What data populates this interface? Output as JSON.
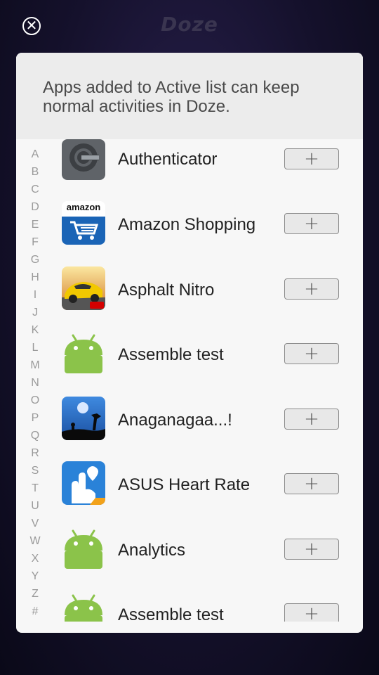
{
  "header": {
    "close_symbol": "✕",
    "title": "Doze"
  },
  "dialog": {
    "description": "Apps added to Active list can keep normal activities in Doze."
  },
  "alphabet_index": [
    "A",
    "B",
    "C",
    "D",
    "E",
    "F",
    "G",
    "H",
    "I",
    "J",
    "K",
    "L",
    "M",
    "N",
    "O",
    "P",
    "Q",
    "R",
    "S",
    "T",
    "U",
    "V",
    "W",
    "X",
    "Y",
    "Z",
    "#"
  ],
  "apps": [
    {
      "name": "Authenticator",
      "icon": "authenticator-icon",
      "add_label": "+"
    },
    {
      "name": "Amazon Shopping",
      "icon": "amazon-icon",
      "icon_text": "amazon",
      "add_label": "+"
    },
    {
      "name": "Asphalt Nitro",
      "icon": "asphalt-icon",
      "add_label": "+"
    },
    {
      "name": "Assemble test",
      "icon": "android-icon",
      "add_label": "+"
    },
    {
      "name": "Anaganagaa...!",
      "icon": "anaganagaa-icon",
      "add_label": "+"
    },
    {
      "name": "ASUS Heart Rate",
      "icon": "heart-rate-icon",
      "add_label": "+"
    },
    {
      "name": "Analytics",
      "icon": "android-icon",
      "add_label": "+"
    },
    {
      "name": "Assemble test",
      "icon": "android-icon",
      "add_label": "+"
    }
  ],
  "colors": {
    "android_green": "#8bc34a",
    "amazon_blue": "#1a64b6",
    "dialog_bg": "#f7f7f7",
    "header_bg": "#ececec"
  }
}
